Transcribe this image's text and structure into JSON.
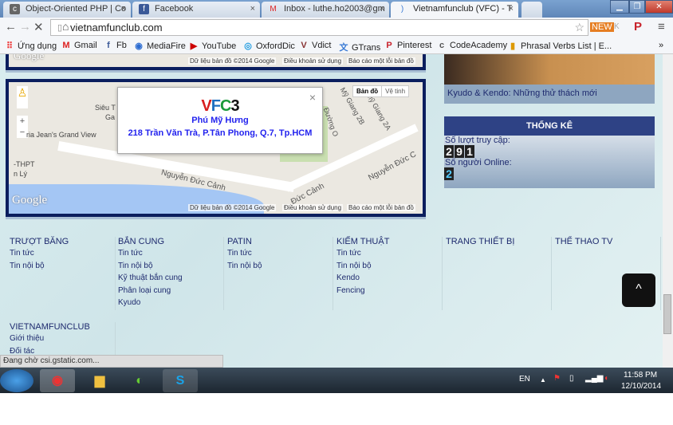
{
  "browser": {
    "tabs": [
      {
        "title": "Object-Oriented PHP | Co",
        "icon": "c"
      },
      {
        "title": "Facebook",
        "icon": "f"
      },
      {
        "title": "Inbox - luthe.ho2003@gm",
        "icon": "M"
      },
      {
        "title": "Vietnamfunclub (VFC) - T",
        "icon": "loading"
      }
    ],
    "url": "vietnamfunclub.com",
    "bookmarks": [
      "Ứng dụng",
      "Gmail",
      "Fb",
      "MediaFire",
      "YouTube",
      "OxfordDic",
      "Vdict",
      "GTrans",
      "Pinterest",
      "CodeAcademy",
      "Phrasal Verbs List | E..."
    ],
    "bookmarks_more": "»",
    "status": "Đang chờ csi.gstatic.com..."
  },
  "map": {
    "attribution": "Dữ liệu bản đồ ©2014 Google",
    "terms": "Điều khoản sử dụng",
    "report": "Báo cáo một lỗi bản đồ",
    "logo": "Google",
    "type_map": "Bản đồ",
    "type_satellite": "Vệ tinh",
    "zoom_in": "+",
    "zoom_out": "−",
    "labels": [
      "Siêu T",
      "Ga",
      "ria Jean's Grand View",
      "-THPT",
      "n Lý",
      "Nguyễn Đức Cảnh",
      "Nguyễn Đức C",
      "Đức Cảnh",
      "Đường O",
      "Mỹ Giang 2B",
      "Mỹ Giang 2A"
    ],
    "info": {
      "logo": "VFC3",
      "name": "Phú Mỹ Hưng",
      "address": "218 Trần Văn Trà, P.Tân Phong, Q.7, Tp.HCM",
      "close": "×"
    }
  },
  "sidebar": {
    "article": "Kyudo & Kendo: Những thử thách mới",
    "stats_title": "THỐNG KÊ",
    "visits_label": "Số lượt truy cập:",
    "visits": "291",
    "online_label": "Số người Online:",
    "online": "2"
  },
  "footer": {
    "columns": [
      {
        "title": "TRƯỢT BĂNG",
        "links": [
          "Tin tức",
          "Tin nội bộ"
        ]
      },
      {
        "title": "BẮN CUNG",
        "links": [
          "Tin tức",
          "Tin nội bộ",
          "Kỹ thuật bắn cung",
          "Phân loại cung",
          "Kyudo"
        ]
      },
      {
        "title": "PATIN",
        "links": [
          "Tin tức",
          "Tin nội bộ"
        ]
      },
      {
        "title": "KIẾM THUẬT",
        "links": [
          "Tin tức",
          "Tin nội bộ",
          "Kendo",
          "Fencing"
        ]
      },
      {
        "title": "TRANG THIẾT BỊ",
        "links": []
      },
      {
        "title": "THỂ THAO TV",
        "links": []
      },
      {
        "title": "VIETNAMFUNCLUB",
        "links": [
          "Giới thiệu",
          "Đối tác"
        ]
      }
    ],
    "to_top": "^"
  },
  "taskbar": {
    "lang": "EN",
    "time": "11:58 PM",
    "date": "12/10/2014"
  }
}
